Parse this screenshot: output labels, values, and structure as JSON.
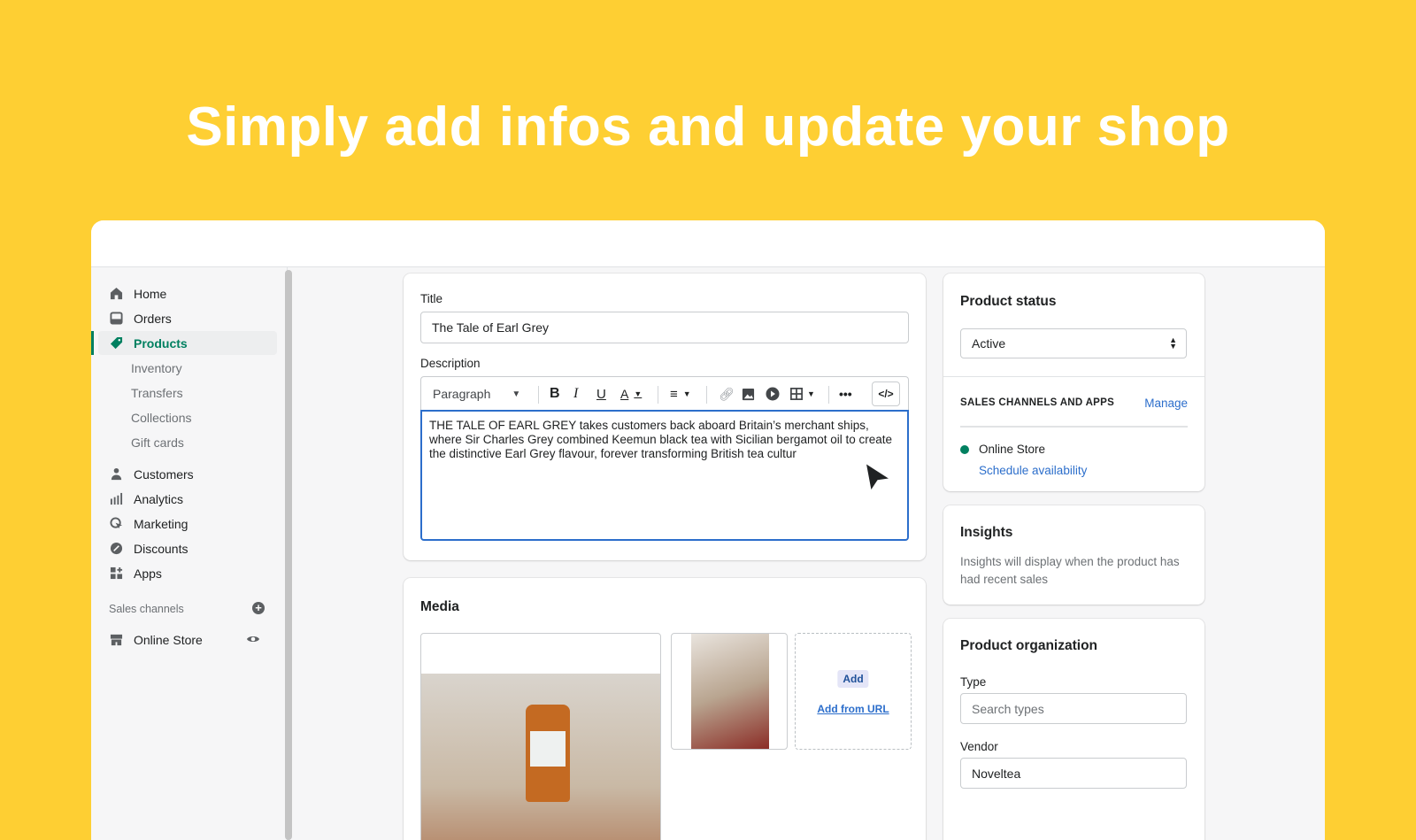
{
  "headline": "Simply add infos and update your shop",
  "sidebar": {
    "items": [
      {
        "label": "Home",
        "icon": "home-icon"
      },
      {
        "label": "Orders",
        "icon": "inbox-icon"
      },
      {
        "label": "Products",
        "icon": "tag-icon",
        "active": true
      },
      {
        "label": "Customers",
        "icon": "person-icon"
      },
      {
        "label": "Analytics",
        "icon": "bar-chart-icon"
      },
      {
        "label": "Marketing",
        "icon": "target-icon"
      },
      {
        "label": "Discounts",
        "icon": "discount-icon"
      },
      {
        "label": "Apps",
        "icon": "apps-icon"
      }
    ],
    "sub_items": [
      "Inventory",
      "Transfers",
      "Collections",
      "Gift cards"
    ],
    "sales_channels_label": "Sales channels",
    "online_store": "Online Store"
  },
  "product": {
    "title_label": "Title",
    "title_value": "The Tale of Earl Grey",
    "description_label": "Description",
    "paragraph_select": "Paragraph",
    "description_text": "THE TALE OF EARL GREY takes customers back aboard Britain’s merchant ships, where Sir Charles Grey combined Keemun black tea with Sicilian bergamot oil to create the distinctive Earl Grey flavour, forever transforming British tea cultur",
    "media_label": "Media",
    "add_button": "Add",
    "add_from_url": "Add from URL"
  },
  "status": {
    "title": "Product status",
    "value": "Active",
    "channels_label": "SALES CHANNELS AND APPS",
    "manage": "Manage",
    "online_store": "Online Store",
    "schedule": "Schedule availability"
  },
  "insights": {
    "title": "Insights",
    "text": "Insights will display when the product has had recent sales"
  },
  "organization": {
    "title": "Product organization",
    "type_label": "Type",
    "type_placeholder": "Search types",
    "vendor_label": "Vendor",
    "vendor_value": "Noveltea"
  },
  "colors": {
    "background": "#fecf33",
    "accent": "#008060",
    "link": "#2c6ecb",
    "focus": "#2c6ecb"
  }
}
